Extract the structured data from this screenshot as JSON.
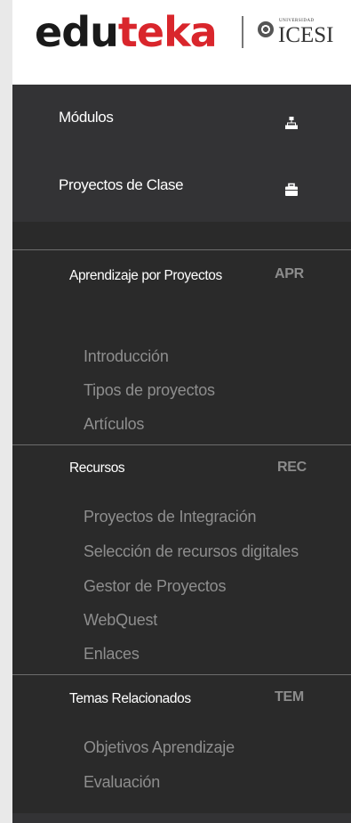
{
  "brand": {
    "logo_part1": "edu",
    "logo_part2": "teka",
    "partner_small": "UNIVERSIDAD",
    "partner_name": "ICESI"
  },
  "topnav": {
    "items": [
      {
        "label": "Módulos",
        "icon": "sitemap-icon"
      },
      {
        "label": "Proyectos de Clase",
        "icon": "briefcase-icon"
      }
    ]
  },
  "sections": [
    {
      "title": "Aprendizaje por Proyectos",
      "abbr": "APR",
      "links": [
        "Introducción",
        "Tipos de proyectos",
        "Artículos"
      ]
    },
    {
      "title": "Recursos",
      "abbr": "REC",
      "links": [
        "Proyectos de Integración",
        "Selección de recursos digitales",
        "Gestor de Proyectos",
        "WebQuest",
        "Enlaces"
      ]
    },
    {
      "title": "Temas Relacionados",
      "abbr": "TEM",
      "links": [
        "Objetivos Aprendizaje",
        "Evaluación"
      ]
    }
  ],
  "colors": {
    "brand_red": "#d9262c",
    "topnav_bg": "#333335",
    "sidebar_bg": "#2a2a2a",
    "link_text": "#8e8e8e"
  }
}
